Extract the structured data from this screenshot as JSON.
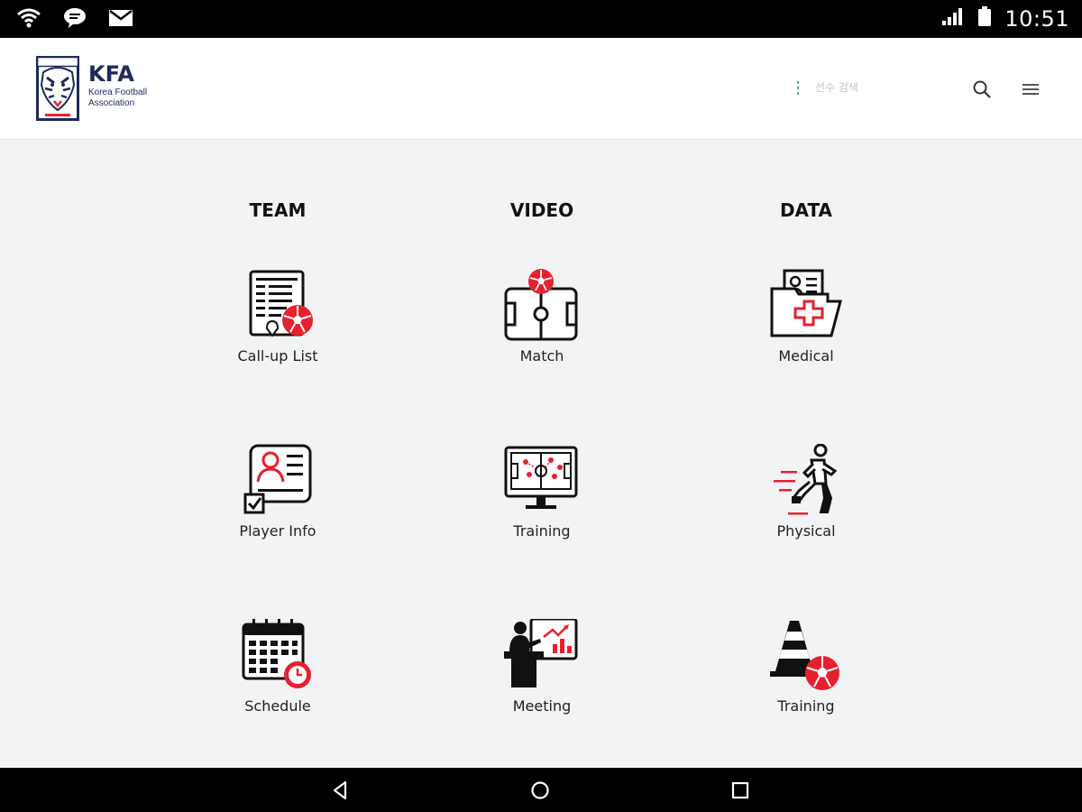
{
  "status_bar": {
    "time": "10:51",
    "icons": [
      "wifi-icon",
      "chat-icon",
      "mail-icon",
      "signal-icon",
      "battery-icon"
    ]
  },
  "header": {
    "logo_abbr": "KFA",
    "logo_full": "Korea Football Association",
    "search_placeholder": "선수 검색",
    "icons": [
      "search-icon",
      "hamburger-menu-icon"
    ]
  },
  "columns": [
    {
      "title": "TEAM",
      "items": [
        {
          "label": "Call-up List",
          "icon": "callup-list-icon"
        },
        {
          "label": "Player Info",
          "icon": "player-info-icon"
        },
        {
          "label": "Schedule",
          "icon": "schedule-calendar-icon"
        }
      ]
    },
    {
      "title": "VIDEO",
      "items": [
        {
          "label": "Match",
          "icon": "match-field-icon"
        },
        {
          "label": "Training",
          "icon": "training-tactics-monitor-icon"
        },
        {
          "label": "Meeting",
          "icon": "meeting-presentation-icon"
        }
      ]
    },
    {
      "title": "DATA",
      "items": [
        {
          "label": "Medical",
          "icon": "medical-folder-icon"
        },
        {
          "label": "Physical",
          "icon": "physical-runner-icon"
        },
        {
          "label": "Training",
          "icon": "training-cone-ball-icon"
        }
      ]
    }
  ],
  "nav_bar": {
    "icons": [
      "back-icon",
      "home-icon",
      "recents-icon"
    ]
  },
  "colors": {
    "accent": "#e8202e",
    "brand_navy": "#1f2a5a",
    "icon_dark": "#111111",
    "background": "#f2f3f5"
  }
}
